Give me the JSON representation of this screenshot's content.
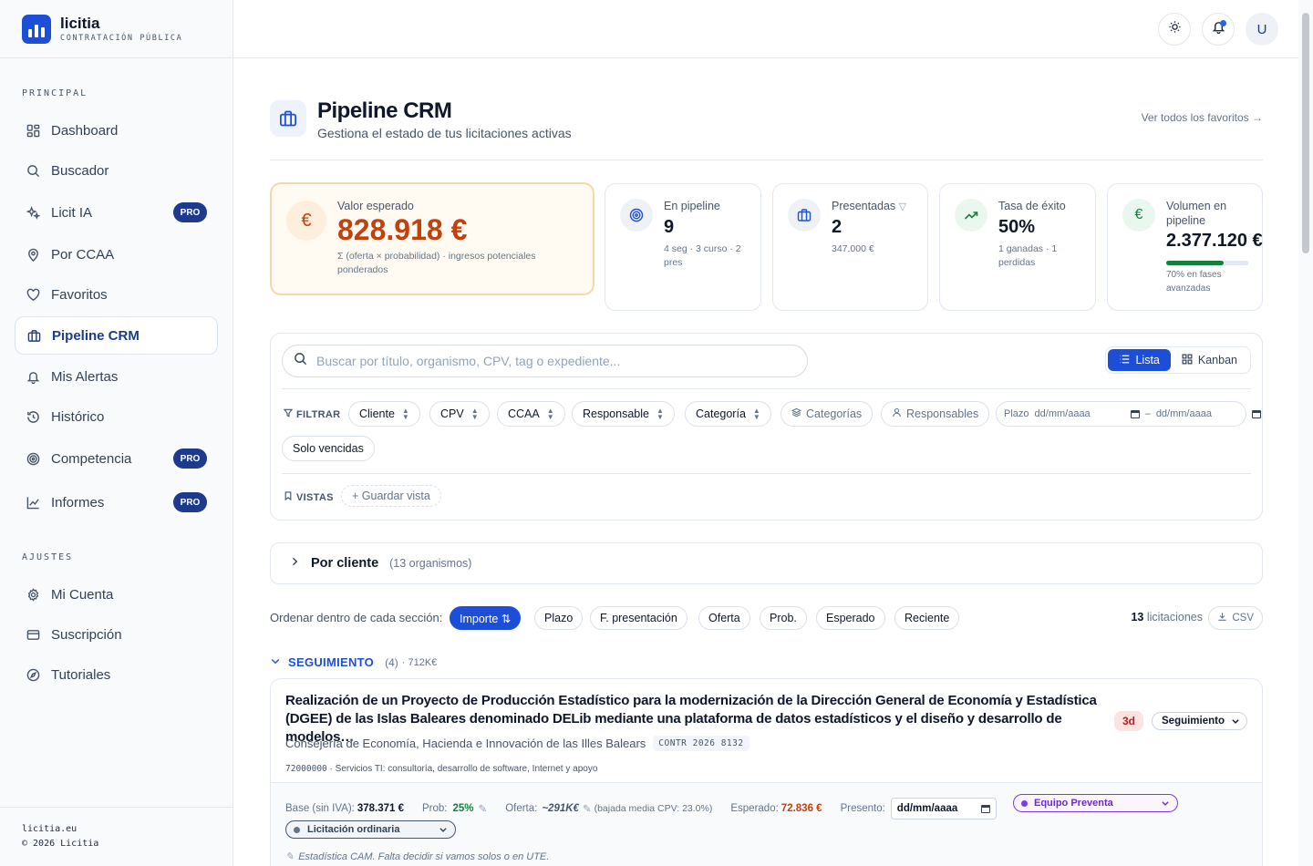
{
  "brand": {
    "name": "licitia",
    "tagline": "CONTRATACIÓN PÚBLICA"
  },
  "sidebar": {
    "section_main": "PRINCIPAL",
    "section_settings": "AJUSTES",
    "items": [
      {
        "label": "Dashboard",
        "icon": "dashboard-icon"
      },
      {
        "label": "Buscador",
        "icon": "search-icon"
      },
      {
        "label": "Licit IA",
        "icon": "sparkles-icon",
        "badge": "PRO"
      },
      {
        "label": "Por CCAA",
        "icon": "map-pin-icon"
      },
      {
        "label": "Favoritos",
        "icon": "heart-icon"
      },
      {
        "label": "Pipeline CRM",
        "icon": "briefcase-icon",
        "active": true
      },
      {
        "label": "Mis Alertas",
        "icon": "bell-icon"
      },
      {
        "label": "Histórico",
        "icon": "history-icon"
      },
      {
        "label": "Competencia",
        "icon": "target-icon",
        "badge": "PRO"
      },
      {
        "label": "Informes",
        "icon": "chart-icon",
        "badge": "PRO"
      }
    ],
    "settings": [
      {
        "label": "Mi Cuenta",
        "icon": "gear-icon"
      },
      {
        "label": "Suscripción",
        "icon": "card-icon"
      },
      {
        "label": "Tutoriales",
        "icon": "compass-icon"
      }
    ],
    "footer": {
      "site": "licitia.eu",
      "copyright": "© 2026 Licitia"
    }
  },
  "topbar": {
    "avatar_initial": "U"
  },
  "page": {
    "title": "Pipeline CRM",
    "subtitle": "Gestiona el estado de tus licitaciones activas",
    "fav_link": "Ver todos los favoritos →"
  },
  "kpis": {
    "expected": {
      "label": "Valor esperado",
      "value": "828.918 €",
      "meta": "Σ (oferta × probabilidad) · ingresos potenciales ponderados",
      "icon": "€"
    },
    "pipeline": {
      "label": "En pipeline",
      "value": "9",
      "meta": "4 seg · 3 curso · 2 pres"
    },
    "submitted": {
      "label": "Presentadas",
      "value": "2",
      "meta": "347.000 €"
    },
    "success": {
      "label": "Tasa de éxito",
      "value": "50%",
      "meta": "1 ganadas · 1 perdidas"
    },
    "volume": {
      "label": "Volumen en pipeline",
      "value": "2.377.120 €",
      "meta": "70% en fases avanzadas",
      "icon": "€",
      "advanced_fraction": 0.7
    }
  },
  "filters": {
    "search_placeholder": "Buscar por título, organismo, CPV, tag o expediente...",
    "view_list": "Lista",
    "view_kanban": "Kanban",
    "filter_label": "FILTRAR",
    "chips": [
      "Cliente",
      "CPV",
      "CCAA",
      "Responsable",
      "Categoría"
    ],
    "categories": "Categorías",
    "responsables": "Responsables",
    "plazo_label": "Plazo",
    "date_placeholder": "dd/mm/aaaa",
    "date_sep": "–",
    "expired": "Solo vencidas",
    "views_label": "VISTAS",
    "save_view": "+ Guardar vista"
  },
  "grouping": {
    "label": "Por cliente",
    "meta": "(13 organismos)"
  },
  "sorting": {
    "label": "Ordenar dentro de cada sección:",
    "options": [
      "Importe ⇅",
      "Plazo",
      "F. presentación",
      "Oferta",
      "Prob.",
      "Esperado",
      "Reciente"
    ],
    "count_num": "13",
    "count_word": "licitaciones",
    "csv": "CSV"
  },
  "stage": {
    "name": "SEGUIMIENTO",
    "count": "(4)",
    "amount": "· 712K€"
  },
  "tender": {
    "title": "Realización de un Proyecto de Producción Estadístico para la modernización de la Dirección General de Economía y Estadística (DGEE) de las Islas Baleares denominado DELib mediante una plataforma de datos estadísticos y el diseño y desarrollo de modelos…",
    "days": "3d",
    "status": "Seguimiento",
    "organism": "Consejería de Economía, Hacienda e Innovación de las Illes Balears",
    "file": "CONTR 2026 8132",
    "cpv_code": "72000000",
    "cpv_desc": "· Servicios TI: consultoría, desarrollo de software, Internet y apoyo",
    "base_label": "Base (sin IVA):",
    "base": "378.371 €",
    "prob_label": "Prob:",
    "prob": "25%",
    "offer_label": "Oferta:",
    "offer": "~291K€",
    "offer_note": "(bajada media CPV: 23.0%)",
    "expected_label": "Esperado:",
    "expected": "72.836 €",
    "presented_label": "Presento:",
    "presented": "dd/mm/aaaa",
    "team": "Equipo Preventa",
    "procedure": "Licitación ordinaria",
    "note": "Estadística CAM. Falta decidir si vamos solos o en UTE."
  },
  "colors": {
    "accent": "#1d4ed8",
    "brand_dark": "#1e3a8a",
    "expected": "#c2410c",
    "success": "#15803d",
    "team": "#7c3aed"
  }
}
